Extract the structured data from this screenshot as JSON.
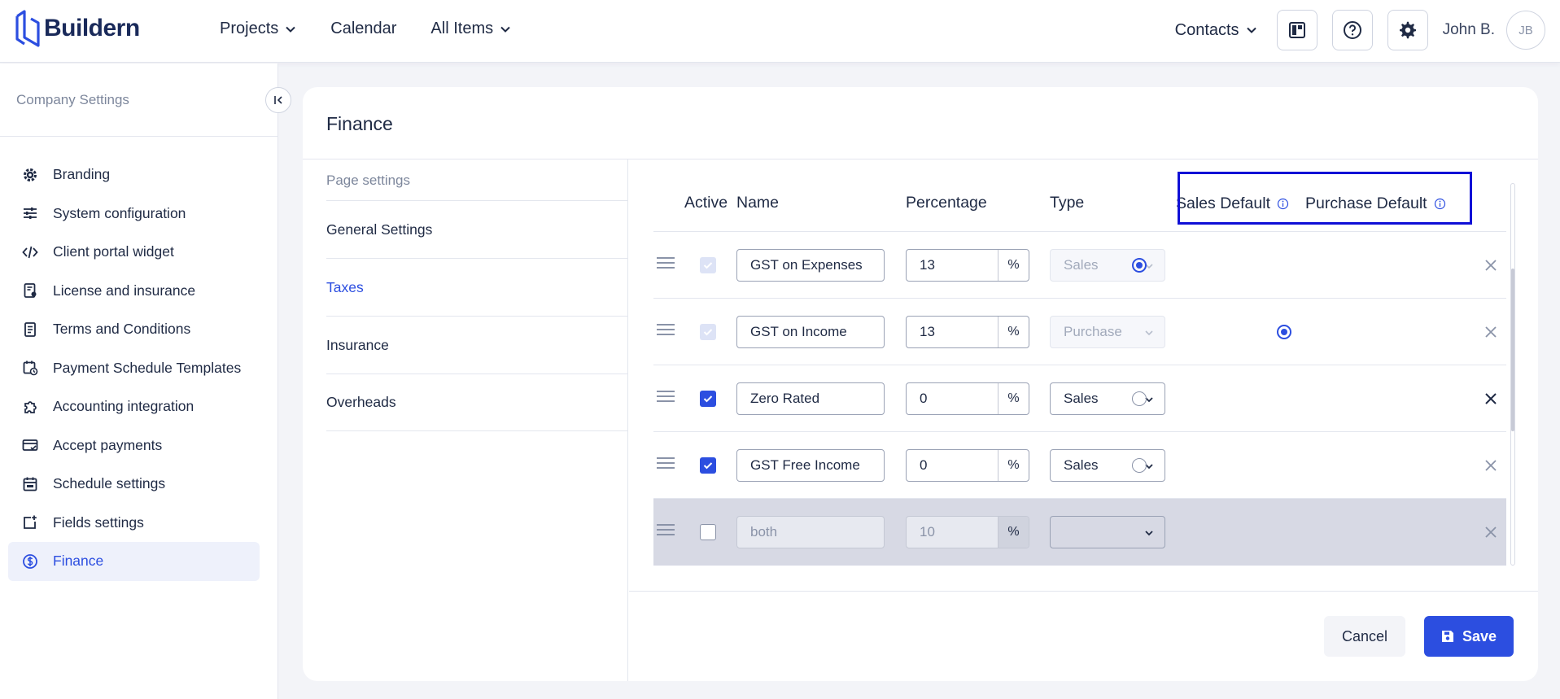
{
  "app": {
    "logo_text": "Buildern"
  },
  "nav": {
    "items": [
      {
        "label": "Projects",
        "icon": "chevron-down-icon"
      },
      {
        "label": "Calendar"
      },
      {
        "label": "All Items",
        "icon": "chevron-down-icon"
      }
    ]
  },
  "topright": {
    "contacts_label": "Contacts",
    "user_name": "John B.",
    "avatar_initials": "JB"
  },
  "sidebar": {
    "title": "Company Settings",
    "items": [
      {
        "label": "Branding",
        "icon": "gear-icon"
      },
      {
        "label": "System configuration",
        "icon": "sliders-icon"
      },
      {
        "label": "Client portal widget",
        "icon": "code-icon"
      },
      {
        "label": "License and insurance",
        "icon": "license-icon"
      },
      {
        "label": "Terms and Conditions",
        "icon": "document-icon"
      },
      {
        "label": "Payment Schedule Templates",
        "icon": "calendar-clock-icon"
      },
      {
        "label": "Accounting integration",
        "icon": "puzzle-icon"
      },
      {
        "label": "Accept payments",
        "icon": "card-icon"
      },
      {
        "label": "Schedule settings",
        "icon": "calendar-icon"
      },
      {
        "label": "Fields settings",
        "icon": "add-field-icon"
      },
      {
        "label": "Finance",
        "icon": "dollar-icon",
        "active": true
      }
    ]
  },
  "page": {
    "title": "Finance",
    "settings_label": "Page settings",
    "settings_items": [
      {
        "label": "General Settings"
      },
      {
        "label": "Taxes",
        "active": true
      },
      {
        "label": "Insurance"
      },
      {
        "label": "Overheads"
      }
    ]
  },
  "table": {
    "headers": {
      "active": "Active",
      "name": "Name",
      "percentage": "Percentage",
      "type": "Type",
      "sales_default": "Sales Default",
      "purchase_default": "Purchase Default"
    },
    "rows": [
      {
        "name": "GST on Expenses",
        "percentage": "13",
        "unit": "%",
        "type": "Sales",
        "active": true,
        "locked": true,
        "sales_default": true,
        "purchase_default": false
      },
      {
        "name": "GST on Income",
        "percentage": "13",
        "unit": "%",
        "type": "Purchase",
        "active": true,
        "locked": true,
        "sales_default": false,
        "purchase_default": true
      },
      {
        "name": "Zero Rated",
        "percentage": "0",
        "unit": "%",
        "type": "Sales",
        "active": true,
        "locked": false,
        "sales_default": false,
        "purchase_default": false
      },
      {
        "name": "GST Free Income",
        "percentage": "0",
        "unit": "%",
        "type": "Sales",
        "active": true,
        "locked": false,
        "sales_default": false,
        "purchase_default": false
      },
      {
        "name": "both",
        "percentage": "10",
        "unit": "%",
        "type": "",
        "active": false,
        "locked": false,
        "disabled_row": true
      }
    ]
  },
  "footer": {
    "cancel_label": "Cancel",
    "save_label": "Save"
  },
  "colors": {
    "accent": "#2c4ee0",
    "highlight": "#1010d6",
    "text": "#1f2a44"
  }
}
